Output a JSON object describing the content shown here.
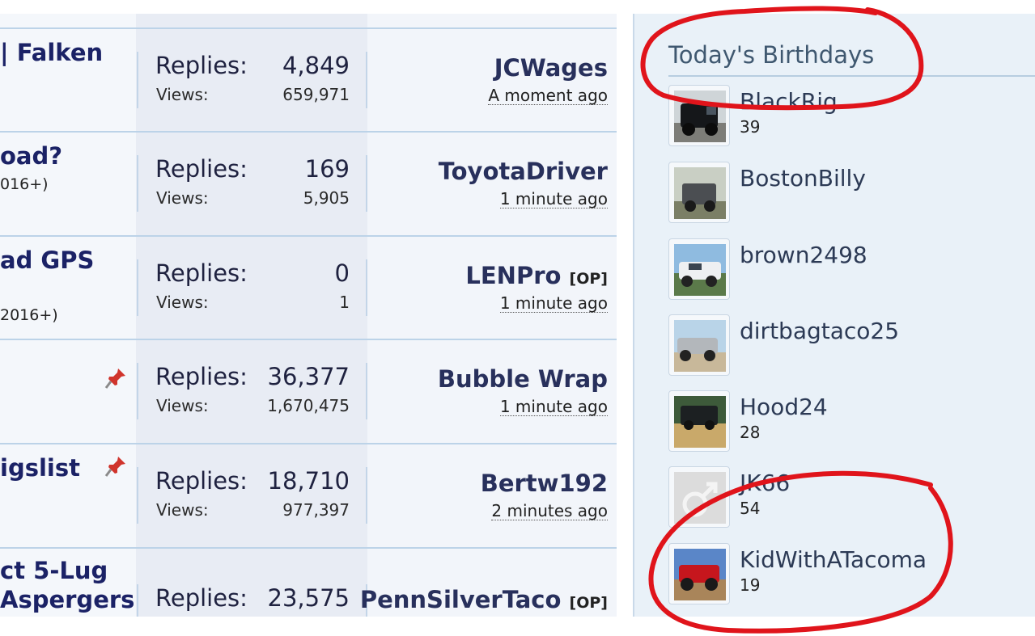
{
  "threads": [
    {
      "title": "| Falken",
      "subforum": "",
      "pinned": false,
      "replies_label": "Replies:",
      "replies": "4,849",
      "views_label": "Views:",
      "views": "659,971",
      "last_user": "JCWages",
      "op": "",
      "last_time": "A moment ago"
    },
    {
      "title": "oad?",
      "subforum": "016+)",
      "pinned": false,
      "replies_label": "Replies:",
      "replies": "169",
      "views_label": "Views:",
      "views": "5,905",
      "last_user": "ToyotaDriver",
      "op": "",
      "last_time": "1 minute ago"
    },
    {
      "title": "ad GPS",
      "subforum": "2016+)",
      "pinned": false,
      "replies_label": "Replies:",
      "replies": "0",
      "views_label": "Views:",
      "views": "1",
      "last_user": "LENPro",
      "op": "[OP]",
      "last_time": "1 minute ago"
    },
    {
      "title": "",
      "subforum": "",
      "pinned": true,
      "replies_label": "Replies:",
      "replies": "36,377",
      "views_label": "Views:",
      "views": "1,670,475",
      "last_user": "Bubble Wrap",
      "op": "",
      "last_time": "1 minute ago"
    },
    {
      "title": "igslist",
      "subforum": "",
      "pinned": true,
      "replies_label": "Replies:",
      "replies": "18,710",
      "views_label": "Views:",
      "views": "977,397",
      "last_user": "Bertw192",
      "op": "",
      "last_time": "2 minutes ago"
    },
    {
      "title": "ct 5-Lug",
      "title2": "Aspergers",
      "subforum": "",
      "pinned": false,
      "replies_label": "Replies:",
      "replies": "23,575",
      "views_label": "",
      "views": "",
      "last_user": "PennSilverTaco",
      "op": "[OP]",
      "last_time": ""
    }
  ],
  "birthdays": {
    "title": "Today's Birthdays",
    "members": [
      {
        "name": "BlackRig",
        "age": "39",
        "avatar": "black-truck-photo"
      },
      {
        "name": "BostonBilly",
        "age": "",
        "avatar": "gray-jeep-photo"
      },
      {
        "name": "brown2498",
        "age": "",
        "avatar": "white-truck-photo"
      },
      {
        "name": "dirtbagtaco25",
        "age": "",
        "avatar": "silver-truck-photo"
      },
      {
        "name": "Hood24",
        "age": "28",
        "avatar": "truck-in-field-photo"
      },
      {
        "name": "JK66",
        "age": "54",
        "avatar": "default-male-avatar"
      },
      {
        "name": "KidWithATacoma",
        "age": "19",
        "avatar": "red-truck-photo"
      }
    ]
  },
  "colors": {
    "accent_title": "#1b2266",
    "annotation": "#e0141b",
    "panel_bg": "#e9f1f8"
  }
}
